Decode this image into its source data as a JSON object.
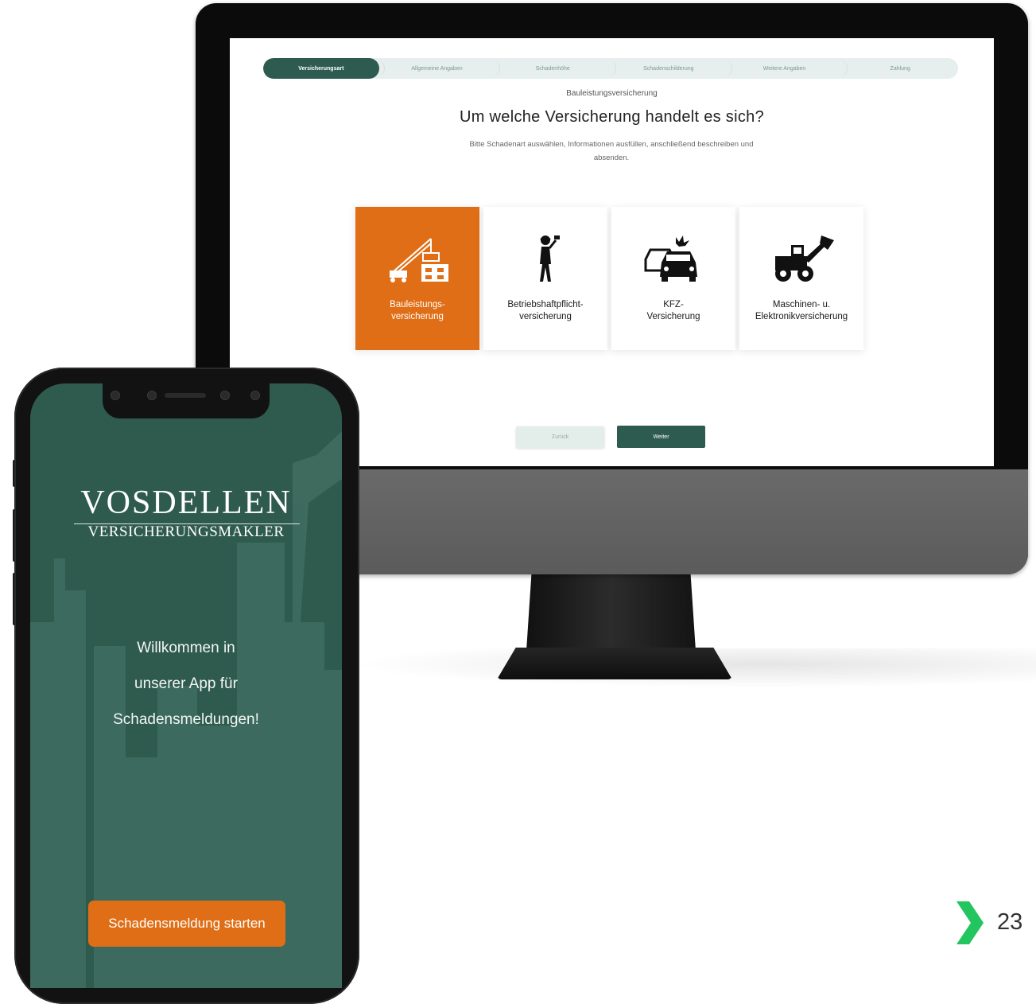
{
  "desktop": {
    "progress_steps": [
      {
        "label": "Versicherungsart",
        "active": true
      },
      {
        "label": "Allgemeine Angaben",
        "active": false
      },
      {
        "label": "Schadenhöhe",
        "active": false
      },
      {
        "label": "Schadenschilderung",
        "active": false
      },
      {
        "label": "Weitere Angaben",
        "active": false
      },
      {
        "label": "Zahlung",
        "active": false
      }
    ],
    "overline": "Bauleistungsversicherung",
    "headline": "Um welche Versicherung handelt es sich?",
    "subtext": "Bitte Schadenart auswählen, Informationen ausfüllen, anschließend beschreiben und absenden.",
    "cards": [
      {
        "label": "Bauleistungs-\nversicherung",
        "icon": "crane-building-icon",
        "selected": true
      },
      {
        "label": "Betriebshaftpflicht-\nversicherung",
        "icon": "worker-icon",
        "selected": false
      },
      {
        "label": "KFZ-\nVersicherung",
        "icon": "car-crash-icon",
        "selected": false
      },
      {
        "label": "Maschinen- u.\nElektronikversicherung",
        "icon": "wheel-loader-icon",
        "selected": false
      }
    ],
    "back_label": "Zurück",
    "next_label": "Weiter",
    "colors": {
      "primary": "#2e5b4f",
      "accent": "#e06e16",
      "progress_bg": "#e6efed"
    }
  },
  "mobile": {
    "logo_main": "VOSDELLEN",
    "logo_sub": "VERSICHERUNGSMAKLER",
    "welcome": "Willkommen in\nunserer App für\nSchadensmeldungen!",
    "cta_label": "Schadensmeldung starten",
    "colors": {
      "background": "#2f5b4f",
      "button": "#e06e16"
    }
  },
  "page": {
    "number": "23",
    "arrow_icon": "chevron-right-icon",
    "arrow_color": "#22c55e"
  }
}
